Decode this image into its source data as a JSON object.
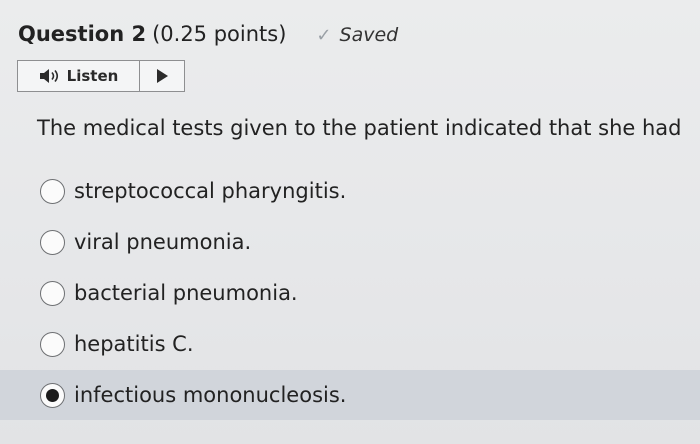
{
  "question": {
    "title": "Question 2",
    "points": "(0.25 points)",
    "saved_status": "Saved",
    "text": "The medical tests given to the patient indicated that she had"
  },
  "listen": {
    "label": "Listen",
    "speaker_icon": "speaker-icon",
    "play_icon": "play-icon"
  },
  "options": [
    {
      "label": "streptococcal pharyngitis.",
      "selected": false
    },
    {
      "label": "viral pneumonia.",
      "selected": false
    },
    {
      "label": "bacterial pneumonia.",
      "selected": false
    },
    {
      "label": "hepatitis C.",
      "selected": false
    },
    {
      "label": "infectious mononucleosis.",
      "selected": true
    }
  ],
  "colors": {
    "background": "#e7e8ea",
    "selected_row": "#d1d5db",
    "text": "#222222",
    "check": "#9aa0a6"
  }
}
